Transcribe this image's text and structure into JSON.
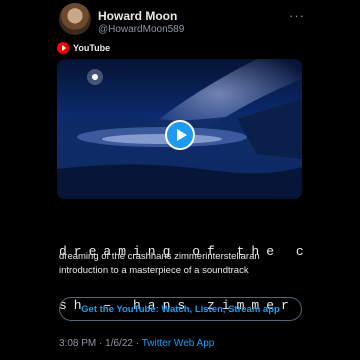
{
  "author": {
    "display_name": "Howard Moon",
    "handle": "@HowardMoon589"
  },
  "menu": {
    "more_label": "···"
  },
  "card": {
    "provider": "YouTube",
    "title_line1": "dreaming of the cra",
    "title_line2": "sh – hans zimmer (…",
    "description": "dreaming of the crashhans zimmerinterstellaran introduction to a masterpiece of a soundtrack",
    "cta_label": "Get the YouTube: Watch, Listen, Stream app"
  },
  "meta": {
    "time": "3:08 PM",
    "separator": "·",
    "date": "1/6/22",
    "source": "Twitter Web App"
  },
  "icons": {
    "provider_logo": "youtube-logo-icon",
    "play": "play-icon",
    "more": "more-icon"
  },
  "colors": {
    "accent": "#1d9bf0",
    "youtube_red": "#ff0000",
    "background": "#000000"
  }
}
